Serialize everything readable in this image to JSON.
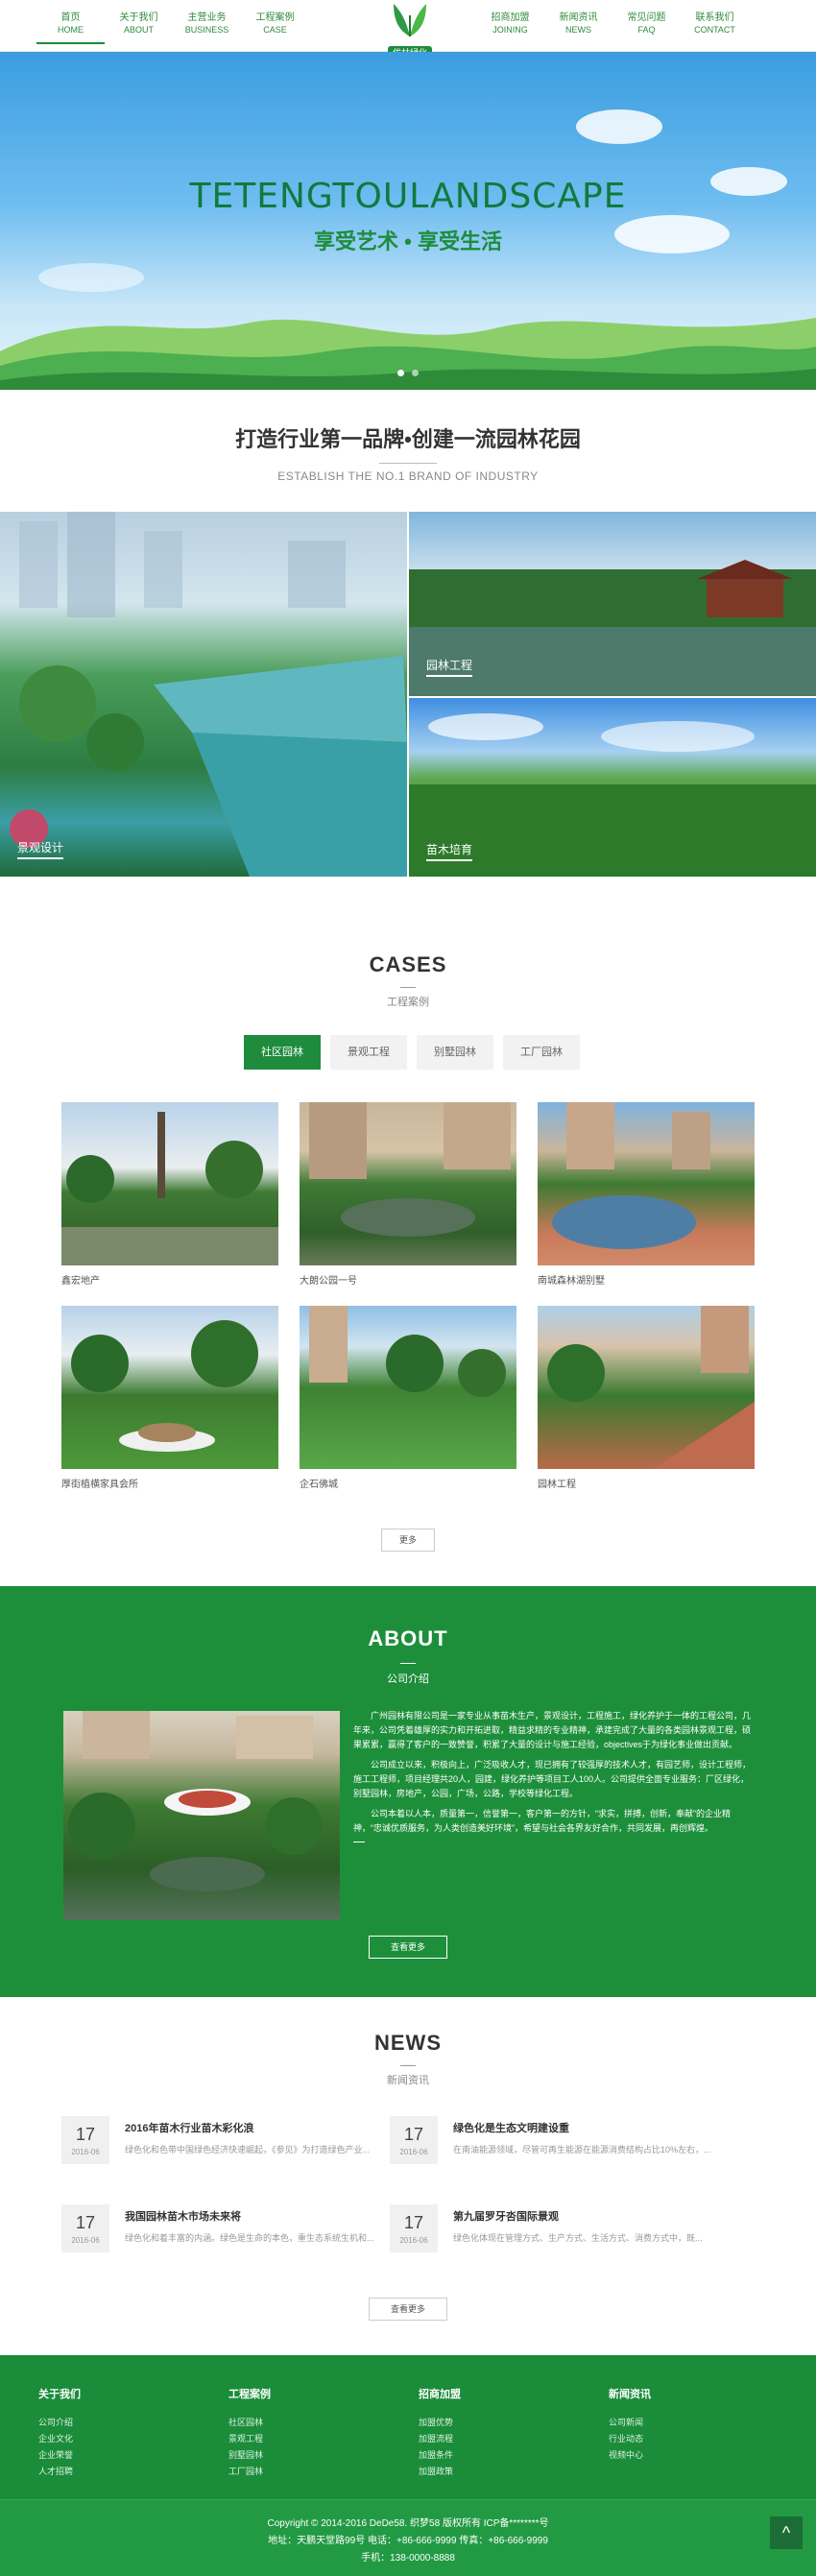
{
  "nav": {
    "left": [
      {
        "cn": "首页",
        "en": "HOME"
      },
      {
        "cn": "关于我们",
        "en": "ABOUT"
      },
      {
        "cn": "主营业务",
        "en": "BUSINESS"
      },
      {
        "cn": "工程案例",
        "en": "CASE"
      }
    ],
    "right": [
      {
        "cn": "招商加盟",
        "en": "JOINING"
      },
      {
        "cn": "新闻资讯",
        "en": "NEWS"
      },
      {
        "cn": "常见问题",
        "en": "FAQ"
      },
      {
        "cn": "联系我们",
        "en": "CONTACT"
      }
    ],
    "logo_text": "优林绿化"
  },
  "banner": {
    "title": "TETENGTOULANDSCAPE",
    "subtitle": "享受艺术 • 享受生活"
  },
  "intro": {
    "title": "打造行业第一品牌•创建一流园林花园",
    "en": "ESTABLISH THE NO.1 BRAND OF INDUSTRY"
  },
  "services": [
    {
      "label": "景观设计"
    },
    {
      "label": "园林工程"
    },
    {
      "label": "苗木培育"
    }
  ],
  "cases": {
    "title": "CASES",
    "subtitle": "工程案例",
    "tabs": [
      "社区园林",
      "景观工程",
      "别墅园林",
      "工厂园林"
    ],
    "items": [
      {
        "caption": "鑫宏地产"
      },
      {
        "caption": "大朗公园一号"
      },
      {
        "caption": "南城森林湖别墅"
      },
      {
        "caption": "厚街植横家具会所"
      },
      {
        "caption": "企石佛城"
      },
      {
        "caption": "园林工程"
      }
    ],
    "more": "更多"
  },
  "about": {
    "title": "ABOUT",
    "subtitle": "公司介绍",
    "paragraphs": [
      "广州园林有限公司是一家专业从事苗木生产，景观设计，工程施工，绿化养护于一体的工程公司，几年来，公司凭着雄厚的实力和开拓进取，精益求精的专业精神，承建完成了大量的各类园林景观工程，硕果累累，赢得了客户的一致赞誉，积累了大量的设计与施工经验，objectives于为绿化事业做出贡献。",
      "公司成立以来，积极向上，广泛吸收人才，现已拥有了较强厚的技术人才，有园艺师，设计工程师，施工工程师，项目经理共20人，园建，绿化养护等项目工人100人。公司提供全面专业服务：厂区绿化，别墅园林，房地产，公园，广场，公路，学校等绿化工程。",
      "公司本着以人本，质量第一，信誉第一，客户第一的方针，“求实，拼搏，创新，奉献”的企业精神，“忠诚优质服务，为人类创造美好环境”，希望与社会各界友好合作，共同发展，再创辉煌。"
    ],
    "button": "查看更多"
  },
  "news": {
    "title": "NEWS",
    "subtitle": "新闻资讯",
    "items": [
      {
        "day": "17",
        "ym": "2016-06",
        "title": "2016年苗木行业苗木彩化浪",
        "desc": "绿色化和色带中国绿色经济快速崛起，《参见》为打造绿色产业..."
      },
      {
        "day": "17",
        "ym": "2016-06",
        "title": "绿色化是生态文明建设重",
        "desc": "在南油能源领域，尽管可再生能源在能源消费结构占比10%左右，..."
      },
      {
        "day": "17",
        "ym": "2016-06",
        "title": "我国园林苗木市场未来将",
        "desc": "绿色化和着丰富的内涵。绿色是生命的本色，重生态系统生机和..."
      },
      {
        "day": "17",
        "ym": "2016-06",
        "title": "第九届罗牙呇国际景观",
        "desc": "绿色化体现在管理方式、生产方式、生活方式、消费方式中，既..."
      }
    ],
    "more": "查看更多"
  },
  "footer": {
    "columns": [
      {
        "title": "关于我们",
        "links": [
          "公司介绍",
          "企业文化",
          "企业荣誉",
          "人才招聘"
        ]
      },
      {
        "title": "工程案例",
        "links": [
          "社区园林",
          "景观工程",
          "别墅园林",
          "工厂园林"
        ]
      },
      {
        "title": "招商加盟",
        "links": [
          "加盟优势",
          "加盟流程",
          "加盟条件",
          "加盟政策"
        ]
      },
      {
        "title": "新闻资讯",
        "links": [
          "公司新闻",
          "行业动态",
          "视频中心"
        ]
      }
    ],
    "copyright": "Copyright © 2014-2016 DeDe58. 织梦58 版权所有 ICP备********号",
    "address": "地址：天鹏天堂路99号 电话：+86-666-9999 传真：+86-666-9999",
    "phone": "手机：138-0000-8888",
    "to_top": "^"
  },
  "colors": {
    "brand": "#1e8c3c",
    "footer": "#1a8c3a"
  }
}
